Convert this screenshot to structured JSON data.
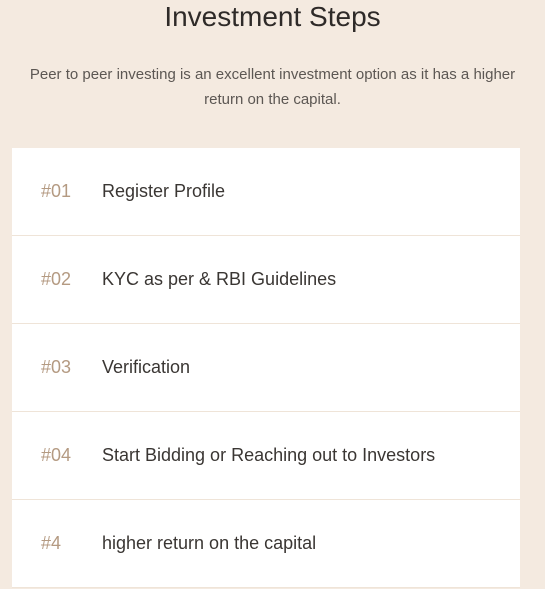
{
  "heading": {
    "title": "Investment Steps",
    "subtitle_line1": "Peer to peer investing is an excellent investment option as it has a higher",
    "subtitle_line2": "return on the capital."
  },
  "steps": [
    {
      "number": "#01",
      "label": "Register Profile"
    },
    {
      "number": "#02",
      "label": "KYC as per & RBI Guidelines"
    },
    {
      "number": "#03",
      "label": "Verification"
    },
    {
      "number": "#04",
      "label": "Start Bidding or Reaching out to Investors"
    },
    {
      "number": "#4",
      "label": "higher return on the capital"
    }
  ],
  "colors": {
    "background": "#f4eae0",
    "card": "#ffffff",
    "step_number": "#b49a82",
    "text": "#3a3633"
  }
}
